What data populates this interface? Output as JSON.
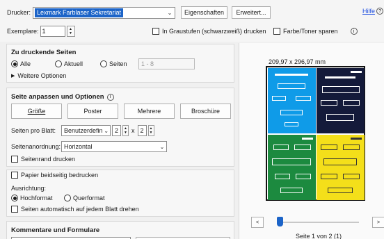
{
  "printer": {
    "label": "Drucker:",
    "selected": "Lexmark Farblaser Sekretariat",
    "properties_button": "Eigenschaften",
    "advanced_button": "Erweitert...",
    "help_link": "Hilfe"
  },
  "copies": {
    "label": "Exemplare:",
    "value": "1",
    "grayscale_label": "In Graustufen (schwarzweiß) drucken",
    "save_toner_label": "Farbe/Toner sparen"
  },
  "pages": {
    "title": "Zu druckende Seiten",
    "all": "Alle",
    "current": "Aktuell",
    "pages": "Seiten",
    "range_placeholder": "1 - 8",
    "more_options": "Weitere Optionen"
  },
  "sizing": {
    "title": "Seite anpassen und Optionen",
    "buttons": [
      "Größe",
      "Poster",
      "Mehrere",
      "Broschüre"
    ],
    "pages_per_sheet_label": "Seiten pro Blatt:",
    "pages_per_sheet_value": "Benutzerdefin",
    "cols": "2",
    "x": "x",
    "rows": "2",
    "order_label": "Seitenanordnung:",
    "order_value": "Horizontal",
    "border_label": "Seitenrand drucken"
  },
  "duplex": {
    "label": "Papier beidseitig bedrucken",
    "orientation_label": "Ausrichtung:",
    "portrait": "Hochformat",
    "landscape": "Querformat",
    "auto_rotate": "Seiten automatisch auf jedem Blatt drehen"
  },
  "comments": {
    "title": "Kommentare und Formulare"
  },
  "preview": {
    "size": "209,97 x 296,97 mm",
    "page_info": "Seite 1 von 2 (1)",
    "prev": "<",
    "next": ">"
  }
}
